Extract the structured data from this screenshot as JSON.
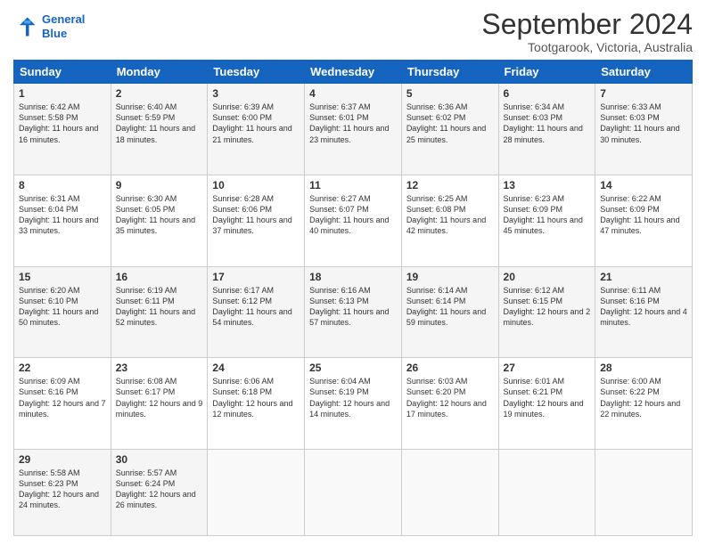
{
  "header": {
    "logo_line1": "General",
    "logo_line2": "Blue",
    "month_title": "September 2024",
    "location": "Tootgarook, Victoria, Australia"
  },
  "days_of_week": [
    "Sunday",
    "Monday",
    "Tuesday",
    "Wednesday",
    "Thursday",
    "Friday",
    "Saturday"
  ],
  "weeks": [
    [
      {
        "day": "1",
        "rise": "6:42 AM",
        "set": "5:58 PM",
        "daylight": "11 hours and 16 minutes."
      },
      {
        "day": "2",
        "rise": "6:40 AM",
        "set": "5:59 PM",
        "daylight": "11 hours and 18 minutes."
      },
      {
        "day": "3",
        "rise": "6:39 AM",
        "set": "6:00 PM",
        "daylight": "11 hours and 21 minutes."
      },
      {
        "day": "4",
        "rise": "6:37 AM",
        "set": "6:01 PM",
        "daylight": "11 hours and 23 minutes."
      },
      {
        "day": "5",
        "rise": "6:36 AM",
        "set": "6:02 PM",
        "daylight": "11 hours and 25 minutes."
      },
      {
        "day": "6",
        "rise": "6:34 AM",
        "set": "6:03 PM",
        "daylight": "11 hours and 28 minutes."
      },
      {
        "day": "7",
        "rise": "6:33 AM",
        "set": "6:03 PM",
        "daylight": "11 hours and 30 minutes."
      }
    ],
    [
      {
        "day": "8",
        "rise": "6:31 AM",
        "set": "6:04 PM",
        "daylight": "11 hours and 33 minutes."
      },
      {
        "day": "9",
        "rise": "6:30 AM",
        "set": "6:05 PM",
        "daylight": "11 hours and 35 minutes."
      },
      {
        "day": "10",
        "rise": "6:28 AM",
        "set": "6:06 PM",
        "daylight": "11 hours and 37 minutes."
      },
      {
        "day": "11",
        "rise": "6:27 AM",
        "set": "6:07 PM",
        "daylight": "11 hours and 40 minutes."
      },
      {
        "day": "12",
        "rise": "6:25 AM",
        "set": "6:08 PM",
        "daylight": "11 hours and 42 minutes."
      },
      {
        "day": "13",
        "rise": "6:23 AM",
        "set": "6:09 PM",
        "daylight": "11 hours and 45 minutes."
      },
      {
        "day": "14",
        "rise": "6:22 AM",
        "set": "6:09 PM",
        "daylight": "11 hours and 47 minutes."
      }
    ],
    [
      {
        "day": "15",
        "rise": "6:20 AM",
        "set": "6:10 PM",
        "daylight": "11 hours and 50 minutes."
      },
      {
        "day": "16",
        "rise": "6:19 AM",
        "set": "6:11 PM",
        "daylight": "11 hours and 52 minutes."
      },
      {
        "day": "17",
        "rise": "6:17 AM",
        "set": "6:12 PM",
        "daylight": "11 hours and 54 minutes."
      },
      {
        "day": "18",
        "rise": "6:16 AM",
        "set": "6:13 PM",
        "daylight": "11 hours and 57 minutes."
      },
      {
        "day": "19",
        "rise": "6:14 AM",
        "set": "6:14 PM",
        "daylight": "11 hours and 59 minutes."
      },
      {
        "day": "20",
        "rise": "6:12 AM",
        "set": "6:15 PM",
        "daylight": "12 hours and 2 minutes."
      },
      {
        "day": "21",
        "rise": "6:11 AM",
        "set": "6:16 PM",
        "daylight": "12 hours and 4 minutes."
      }
    ],
    [
      {
        "day": "22",
        "rise": "6:09 AM",
        "set": "6:16 PM",
        "daylight": "12 hours and 7 minutes."
      },
      {
        "day": "23",
        "rise": "6:08 AM",
        "set": "6:17 PM",
        "daylight": "12 hours and 9 minutes."
      },
      {
        "day": "24",
        "rise": "6:06 AM",
        "set": "6:18 PM",
        "daylight": "12 hours and 12 minutes."
      },
      {
        "day": "25",
        "rise": "6:04 AM",
        "set": "6:19 PM",
        "daylight": "12 hours and 14 minutes."
      },
      {
        "day": "26",
        "rise": "6:03 AM",
        "set": "6:20 PM",
        "daylight": "12 hours and 17 minutes."
      },
      {
        "day": "27",
        "rise": "6:01 AM",
        "set": "6:21 PM",
        "daylight": "12 hours and 19 minutes."
      },
      {
        "day": "28",
        "rise": "6:00 AM",
        "set": "6:22 PM",
        "daylight": "12 hours and 22 minutes."
      }
    ],
    [
      {
        "day": "29",
        "rise": "5:58 AM",
        "set": "6:23 PM",
        "daylight": "12 hours and 24 minutes."
      },
      {
        "day": "30",
        "rise": "5:57 AM",
        "set": "6:24 PM",
        "daylight": "12 hours and 26 minutes."
      },
      null,
      null,
      null,
      null,
      null
    ]
  ]
}
